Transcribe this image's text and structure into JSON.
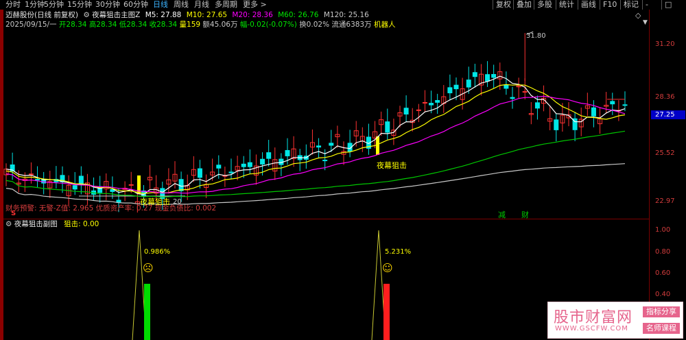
{
  "toolbar": {
    "tabs": [
      "分时",
      "1分钟",
      "5分钟",
      "15分钟",
      "30分钟",
      "60分钟",
      "日线",
      "周线",
      "月线",
      "多周期",
      "更多 >"
    ],
    "active_tab": "日线",
    "right_buttons": [
      "复权",
      "叠加",
      "多股",
      "统计",
      "画线",
      "F10",
      "标记",
      "-",
      "□"
    ]
  },
  "header": {
    "stock_title": "迈赫股份(日线 前复权)",
    "indicator_name": "夜幕狙击主图Z",
    "ma": {
      "m5": "M5: 27.88",
      "m10": "M10: 27.65",
      "m20": "M20: 28.36",
      "m60": "M60: 26.76",
      "m120": "M120: 25.16"
    },
    "date": "2025/09/15/一",
    "open": "开28.34",
    "high": "高28.34",
    "low": "低28.34",
    "close": "收28.34",
    "volume": "量159",
    "amount": "额45.06万",
    "change": "幅-0.02(-0.07%)",
    "turnover": "换0.02%",
    "float": "流通6383万",
    "tag": "机器人"
  },
  "price_axis": {
    "ticks": [
      "31.20",
      "28.36",
      "25.52",
      "22.97"
    ],
    "current_price": "27.25"
  },
  "main_chart": {
    "high_label": "31.80",
    "signal_label_left": "夜幕狙击",
    "signal_label_right": "夜幕狙击",
    "low_label_suffix": "20",
    "finance_line": "财务预警: 无警-Z值: 2.965 优质资产率: 0.27 现金负债比: 0.002",
    "event_markers": [
      "减",
      "财"
    ],
    "s_marker": "S"
  },
  "sub_chart": {
    "title": "夜幕狙击副图",
    "indicator": "狙击: 0.00",
    "ticks": [
      "1.00",
      "0.80",
      "0.60",
      "0.40"
    ],
    "pct_left": "0.986%",
    "pct_right": "5.231%",
    "face_left": "☹",
    "face_right": "☺"
  },
  "watermark": {
    "site_name": "股市财富网",
    "domain": "WWW.GSCFW.COM",
    "tag1": "指标分享",
    "tag2": "名师课程"
  },
  "colors": {
    "up": "#ff3232",
    "down": "#00e6e6",
    "ma5": "#ffffff",
    "ma10": "#ffff00",
    "ma20": "#ff00ff",
    "ma60": "#00c800",
    "ma120": "#c8c8c8"
  }
}
